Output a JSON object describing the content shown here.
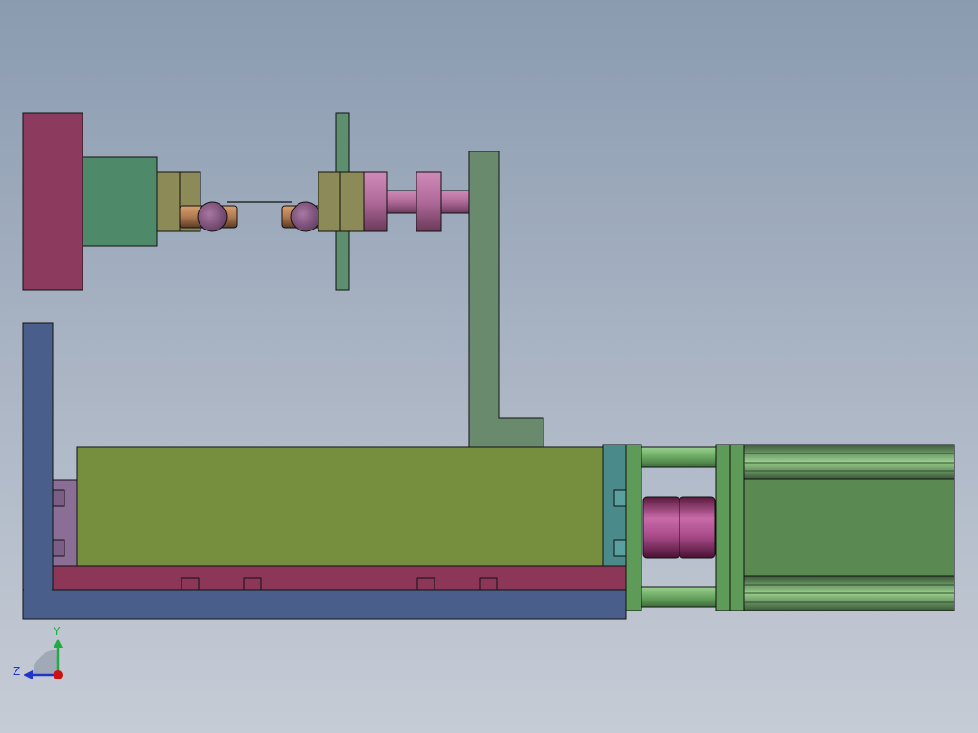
{
  "triad": {
    "y_label": "Y",
    "z_label": "Z",
    "colors": {
      "y_axis": "#22aa44",
      "z_axis": "#2233cc",
      "x_axis_point": "#cc1111"
    }
  },
  "palette": {
    "background_top": "#8a9bb0",
    "background_bottom": "#c6ccd6",
    "base_plate": "#4a5e8c",
    "carriage": "#758f3f",
    "rail": "#8c3758",
    "end_block": "#8a6e96",
    "end_block_right": "#4a8a8a",
    "motor": "#5a8a52",
    "motor_rods": "#6aa862",
    "coupling": "#b04a8a",
    "bracket": "#6a8a6e",
    "top_flange": "#8c3a5e",
    "top_hub": "#4e8a6a",
    "clamp": "#8c8a56",
    "shaft_pin": "#b07a50",
    "ball": "#8a5a86",
    "vertical_plate": "#5e9070",
    "pink_coupler": "#b06a9a"
  },
  "assembly": {
    "components": [
      "base-plate",
      "linear-carriage",
      "guide-rail",
      "left-end-block",
      "right-end-block",
      "servo-motor",
      "shaft-coupling",
      "support-bracket",
      "top-flange",
      "top-hub",
      "left-clamp",
      "right-clamp",
      "test-specimen-wire",
      "vertical-guide-plate",
      "drive-shaft"
    ]
  }
}
